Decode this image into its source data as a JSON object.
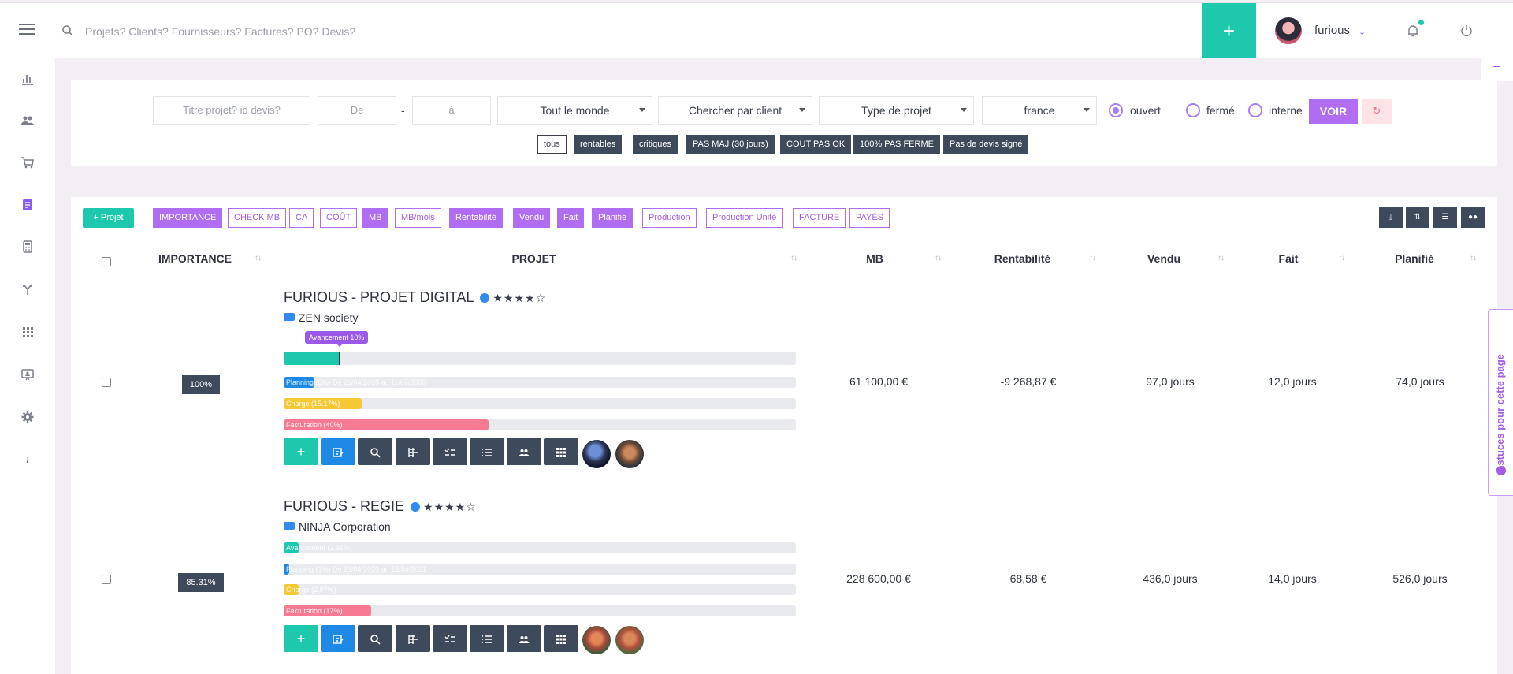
{
  "topbar": {
    "search_placeholder": "Projets? Clients? Fournisseurs? Factures? PO? Devis?",
    "add_label": "+",
    "username": "furious"
  },
  "filters": {
    "title_placeholder": "Titre projet? id devis?",
    "from_placeholder": "De",
    "dash": "-",
    "to_placeholder": "à",
    "everyone": "Tout le monde",
    "client": "Chercher par client",
    "type": "Type de projet",
    "country": "france",
    "status_open": "ouvert",
    "status_closed": "fermé",
    "status_internal": "interne",
    "voir": "VOIR",
    "chips": [
      "tous",
      "rentables",
      "critiques",
      "PAS MAJ (30 jours)",
      "COUT PAS OK",
      "100% PAS FERME",
      "Pas de devis signé"
    ]
  },
  "table": {
    "new_project": "+ Projet",
    "column_buttons": [
      {
        "label": "IMPORTANCE",
        "on": true
      },
      {
        "label": "CHECK MB",
        "on": false
      },
      {
        "label": "CA",
        "on": false
      },
      {
        "label": "COÛT",
        "on": false
      },
      {
        "label": "MB",
        "on": true
      },
      {
        "label": "MB/mois",
        "on": false
      },
      {
        "label": "Rentabilité",
        "on": true
      },
      {
        "label": "Vendu",
        "on": true
      },
      {
        "label": "Fait",
        "on": true
      },
      {
        "label": "Planifié",
        "on": true
      },
      {
        "label": "Production",
        "on": false
      },
      {
        "label": "Production Unité",
        "on": false
      },
      {
        "label": "FACTURE",
        "on": false
      },
      {
        "label": "PAYÉS",
        "on": false
      }
    ],
    "headers": {
      "importance": "IMPORTANCE",
      "projet": "PROJET",
      "mb": "MB",
      "rentabilite": "Rentabilité",
      "vendu": "Vendu",
      "fait": "Fait",
      "planifie": "Planifié"
    },
    "sort_icon": "↑↓",
    "rows": [
      {
        "importance": "100%",
        "title": "FURIOUS - PROJET DIGITAL",
        "stars": "★★★★☆",
        "rating": 4,
        "client": "ZEN society",
        "tooltip": "Avancement 10%",
        "avancement_pct": 11,
        "planning": "Planning (6%) De 23/04/2020 au 11/07/2020",
        "planning_pct": 6,
        "charge": "Charge (15.17%)",
        "charge_pct": 15.17,
        "facturation": "Facturation (40%)",
        "facturation_pct": 40,
        "mb": "61 100,00 €",
        "rentabilite": "-9 268,87 €",
        "vendu": "97,0 jours",
        "fait": "12,0 jours",
        "planifie": "74,0 jours"
      },
      {
        "importance": "85.31%",
        "title": "FURIOUS - REGIE",
        "stars": "★★★★☆",
        "rating": 4,
        "client": "NINJA Corporation",
        "avancement": "Avancement (2.91%)",
        "avancement_pct": 2.91,
        "planning": "Planning (1%) De 23/04/2020 au 22/04/2021",
        "planning_pct": 1,
        "charge": "Charge (2.97%)",
        "charge_pct": 2.97,
        "facturation": "Facturation (17%)",
        "facturation_pct": 17,
        "mb": "228 600,00 €",
        "rentabilite": "68,58 €",
        "vendu": "436,0 jours",
        "fait": "14,0 jours",
        "planifie": "526,0 jours"
      }
    ]
  },
  "tips": {
    "label": "Astuces pour cette page"
  },
  "colors": {
    "accent": "#1ec8ac",
    "purple": "#b06df2",
    "dark": "#3d4a5c",
    "blue": "#1e88e5",
    "yellow": "#f6c836",
    "pink": "#f77a93"
  }
}
